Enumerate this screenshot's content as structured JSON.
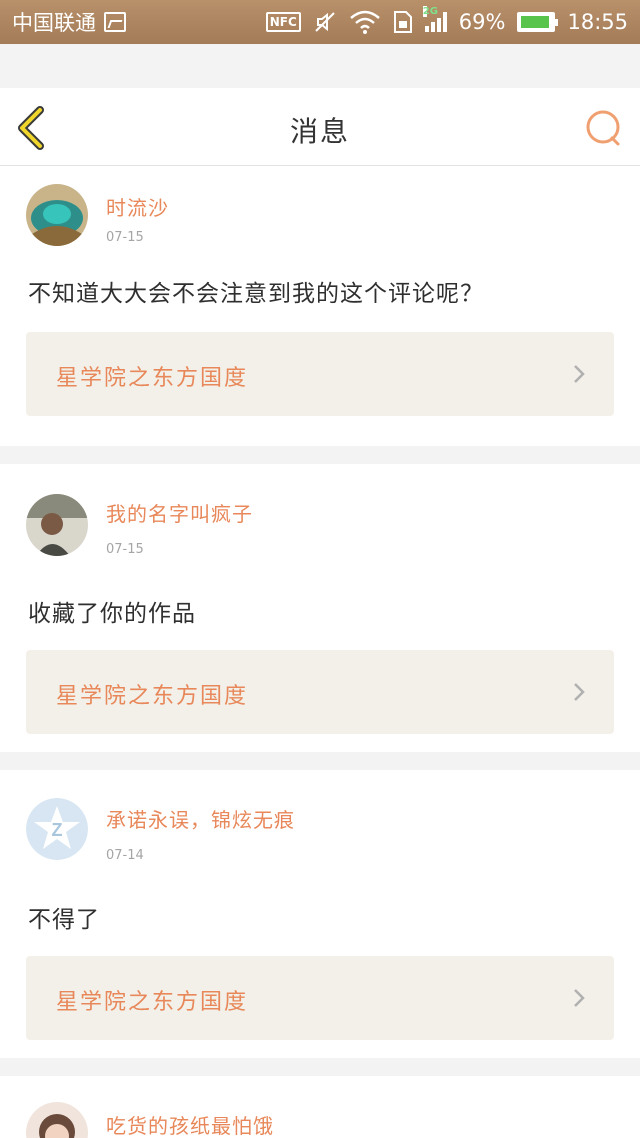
{
  "status_bar": {
    "carrier": "中国联通",
    "nfc": "NFC",
    "network": "2G",
    "battery": "69%",
    "time": "18:55"
  },
  "header": {
    "title": "消息"
  },
  "messages": [
    {
      "user": "时流沙",
      "date": "07-15",
      "text": "不知道大大会不会注意到我的这个评论呢？",
      "link": "星学院之东方国度"
    },
    {
      "user": "我的名字叫疯子",
      "date": "07-15",
      "text": "收藏了你的作品",
      "link": "星学院之东方国度"
    },
    {
      "user": "承诺永误，锦炫无痕",
      "date": "07-14",
      "text": "不得了",
      "link": "星学院之东方国度"
    },
    {
      "user": "吃货的孩纸最怕饿"
    }
  ],
  "colors": {
    "accent": "#e8885a",
    "back_arrow": "#f0d52b",
    "status_bar": "#a88260",
    "link_bg": "#f2f0e8"
  }
}
